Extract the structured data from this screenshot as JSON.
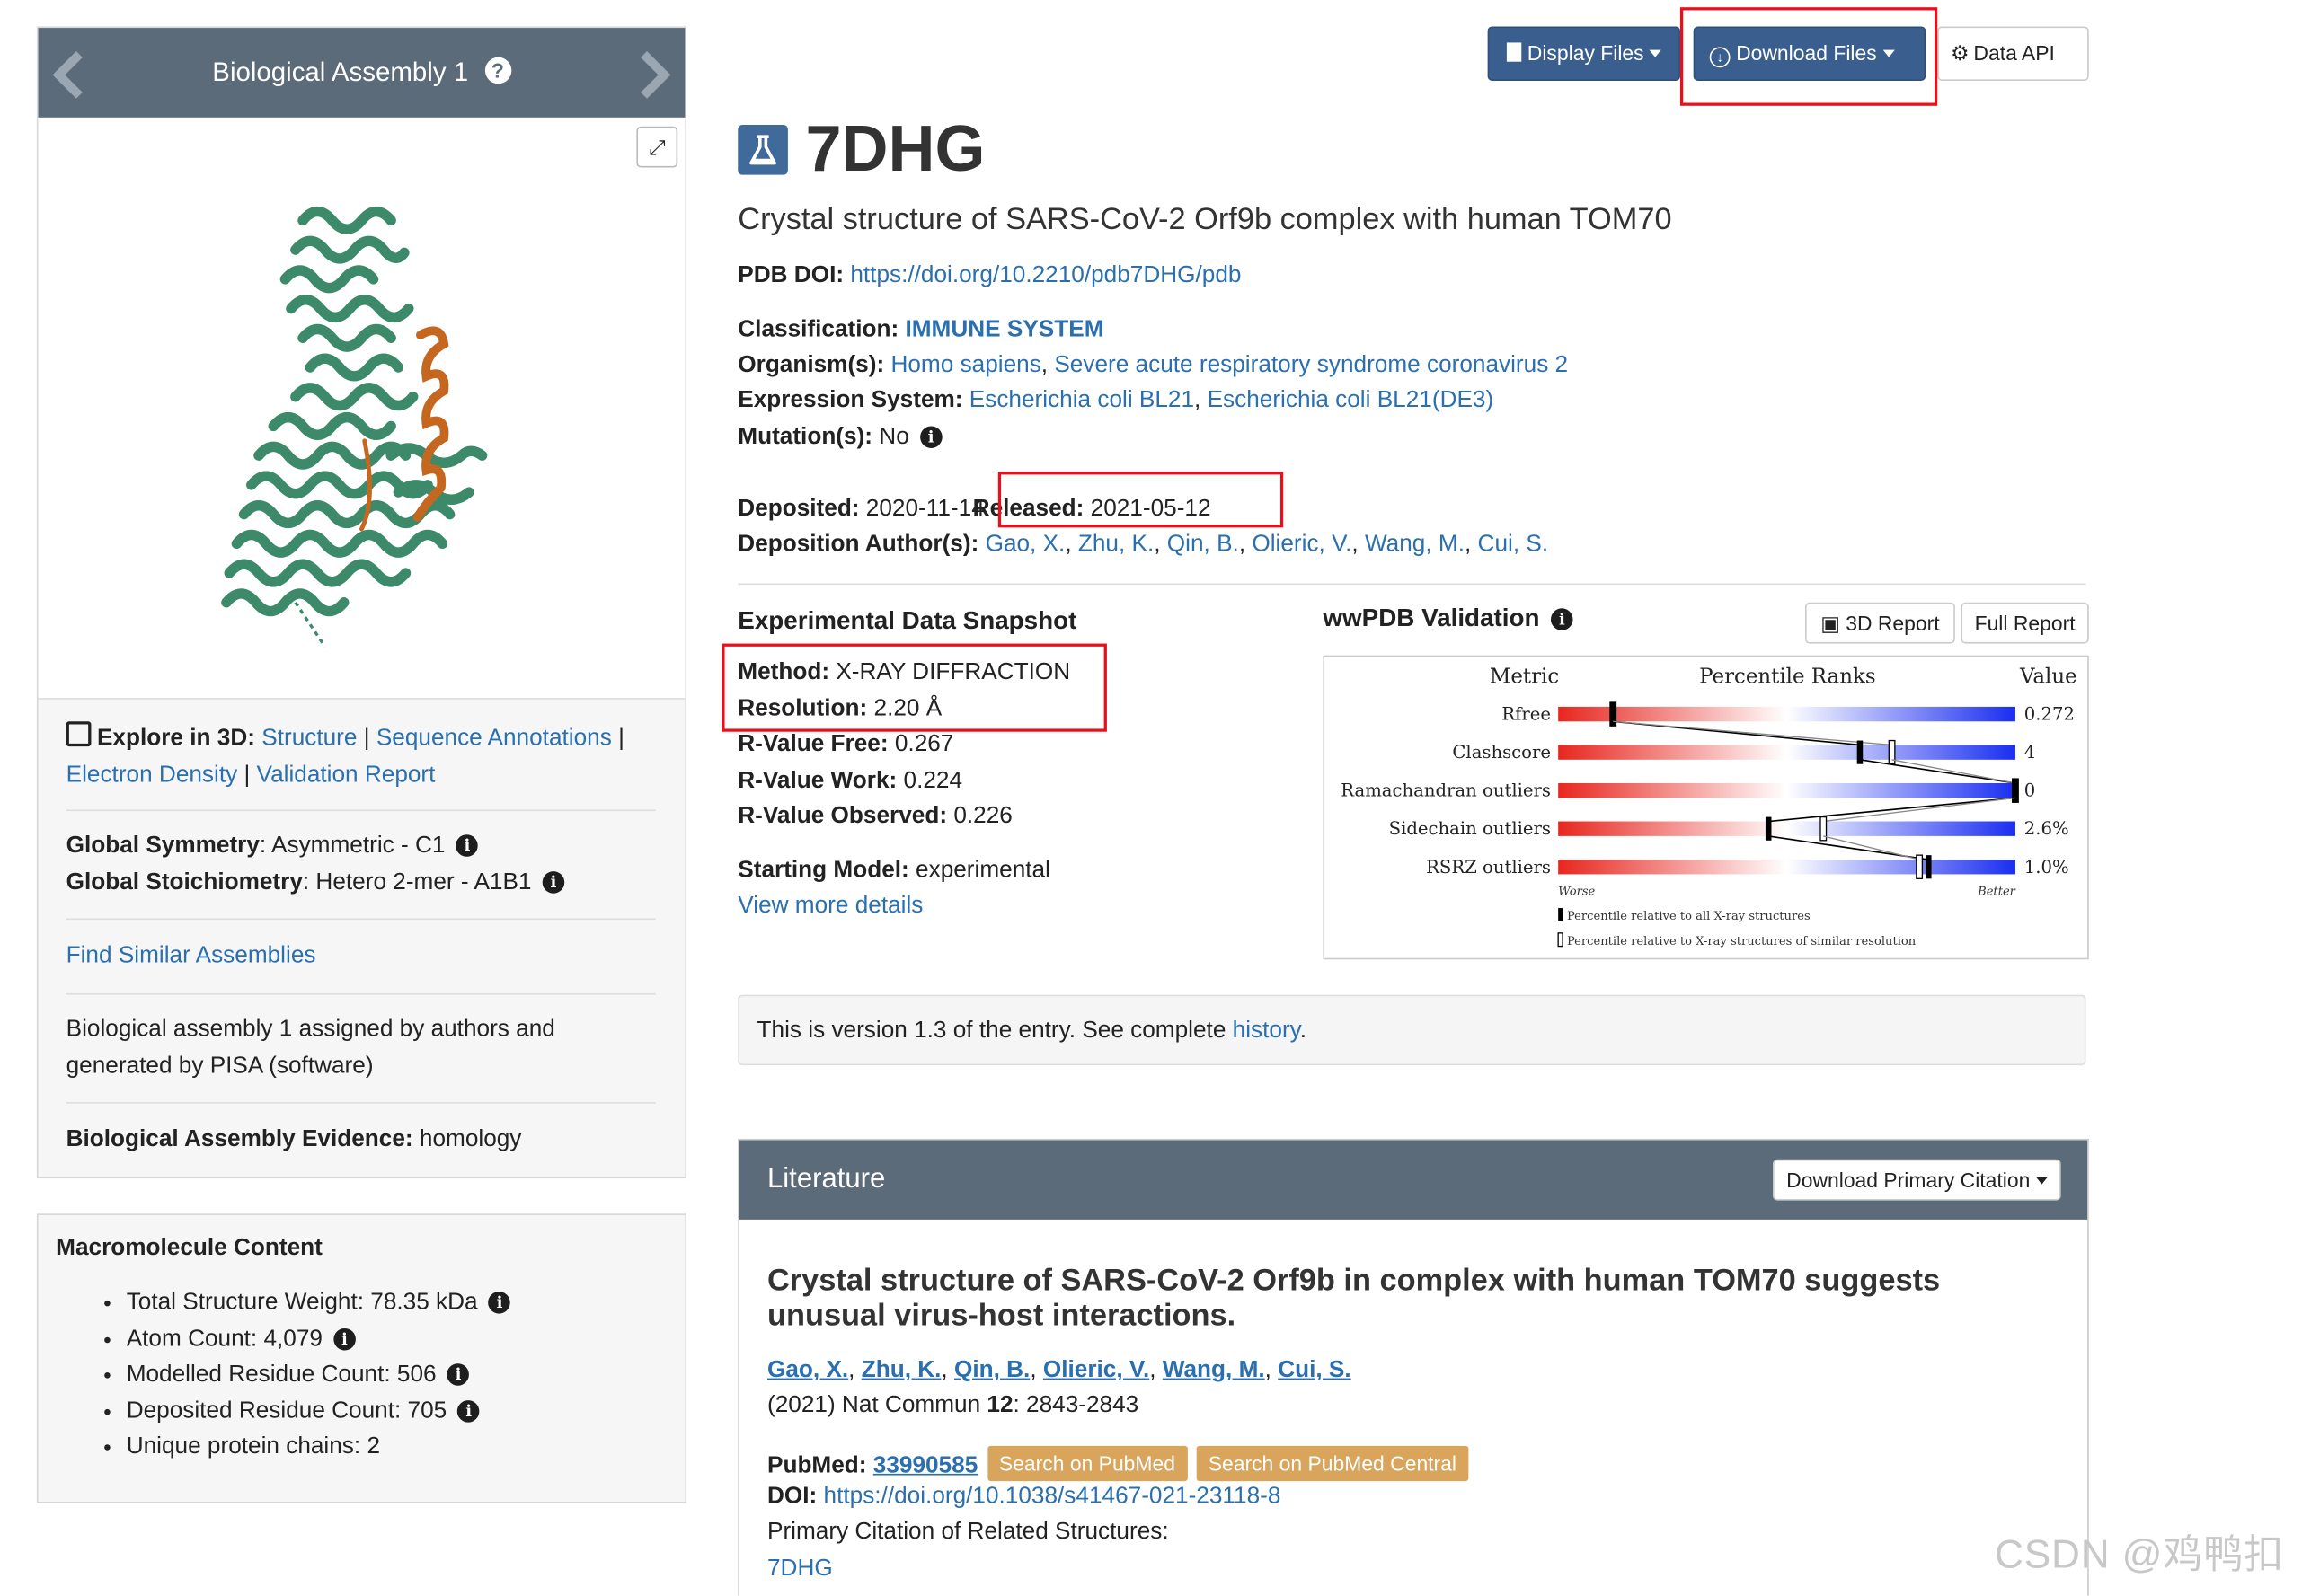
{
  "assembly": {
    "title": "Biological Assembly 1",
    "explore_label": "Explore in 3D",
    "explore_links": [
      "Structure",
      "Sequence Annotations",
      "Electron Density",
      "Validation Report"
    ],
    "symmetry_label": "Global Symmetry",
    "symmetry_value": ": Asymmetric - C1",
    "stoich_label": "Global Stoichiometry",
    "stoich_value": ": Hetero 2-mer - A1B1",
    "find_similar": "Find Similar Assemblies",
    "assigned_text": "Biological assembly 1 assigned by authors and generated by PISA (software)",
    "evidence_label": "Biological Assembly Evidence:",
    "evidence_value": "homology"
  },
  "macro": {
    "title": "Macromolecule Content",
    "items": [
      "Total Structure Weight: 78.35 kDa",
      "Atom Count: 4,079",
      "Modelled Residue Count: 506",
      "Deposited Residue Count: 705",
      "Unique protein chains: 2"
    ]
  },
  "toolbar": {
    "display_files": "Display Files",
    "download_files": "Download Files",
    "data_api": "Data API"
  },
  "entry": {
    "id": "7DHG",
    "title": "Crystal structure of SARS-CoV-2 Orf9b complex with human TOM70",
    "doi_label": "PDB DOI:",
    "doi": "https://doi.org/10.2210/pdb7DHG/pdb",
    "classification_label": "Classification:",
    "classification": "IMMUNE SYSTEM",
    "organism_label": "Organism(s):",
    "organisms": [
      "Homo sapiens",
      "Severe acute respiratory syndrome coronavirus 2"
    ],
    "expression_label": "Expression System:",
    "expression": [
      "Escherichia coli BL21",
      "Escherichia coli BL21(DE3)"
    ],
    "mutation_label": "Mutation(s):",
    "mutation": "No",
    "deposited_label": "Deposited:",
    "deposited": "2020-11-14",
    "released_label": "Released:",
    "released": "2021-05-12",
    "authors_label": "Deposition Author(s):",
    "authors": [
      "Gao, X.",
      "Zhu, K.",
      "Qin, B.",
      "Olieric, V.",
      "Wang, M.",
      "Cui, S."
    ]
  },
  "snapshot": {
    "title": "Experimental Data Snapshot",
    "method_label": "Method:",
    "method": "X-RAY DIFFRACTION",
    "resolution_label": "Resolution:",
    "resolution": "2.20 Å",
    "rfree_label": "R-Value Free:",
    "rfree": "0.267",
    "rwork_label": "R-Value Work:",
    "rwork": "0.224",
    "robs_label": "R-Value Observed:",
    "robs": "0.226",
    "start_label": "Starting Model:",
    "start": "experimental",
    "more": "View more details"
  },
  "validation": {
    "title": "wwPDB Validation",
    "btn_3d": "3D Report",
    "btn_full": "Full Report",
    "col_metric": "Metric",
    "col_ranks": "Percentile Ranks",
    "col_value": "Value",
    "worse": "Worse",
    "better": "Better",
    "legend_all": "Percentile relative to all X-ray structures",
    "legend_similar": "Percentile relative to X-ray structures of similar resolution",
    "colors": {
      "bad": "#e8261f",
      "good": "#1a2ef0"
    },
    "rows": [
      {
        "metric": "Rfree",
        "value": "0.272",
        "all": 0.12,
        "similar": 0.12
      },
      {
        "metric": "Clashscore",
        "value": "4",
        "all": 0.66,
        "similar": 0.73
      },
      {
        "metric": "Ramachandran outliers",
        "value": "0",
        "all": 1.0,
        "similar": 1.0
      },
      {
        "metric": "Sidechain outliers",
        "value": "2.6%",
        "all": 0.46,
        "similar": 0.58
      },
      {
        "metric": "RSRZ outliers",
        "value": "1.0%",
        "all": 0.81,
        "similar": 0.79
      }
    ]
  },
  "version": {
    "text": "This is version 1.3 of the entry. See complete ",
    "link": "history",
    "tail": "."
  },
  "literature": {
    "header": "Literature",
    "download_btn": "Download Primary Citation",
    "title": "Crystal structure of SARS-CoV-2 Orf9b in complex with human TOM70 suggests unusual virus-host interactions.",
    "authors": [
      "Gao, X.",
      "Zhu, K.",
      "Qin, B.",
      "Olieric, V.",
      "Wang, M.",
      "Cui, S."
    ],
    "journal_prefix": "(2021) Nat Commun ",
    "volume": "12",
    "pages": ": 2843-2843",
    "pubmed_label": "PubMed:",
    "pubmed_id": "33990585",
    "search_pubmed": "Search on PubMed",
    "search_pmc": "Search on PubMed Central",
    "doi_label": "DOI:",
    "doi": "https://doi.org/10.1038/s41467-021-23118-8",
    "related_label": "Primary Citation of Related Structures:",
    "related": "7DHG"
  },
  "watermark": "CSDN @鸡鸭扣"
}
